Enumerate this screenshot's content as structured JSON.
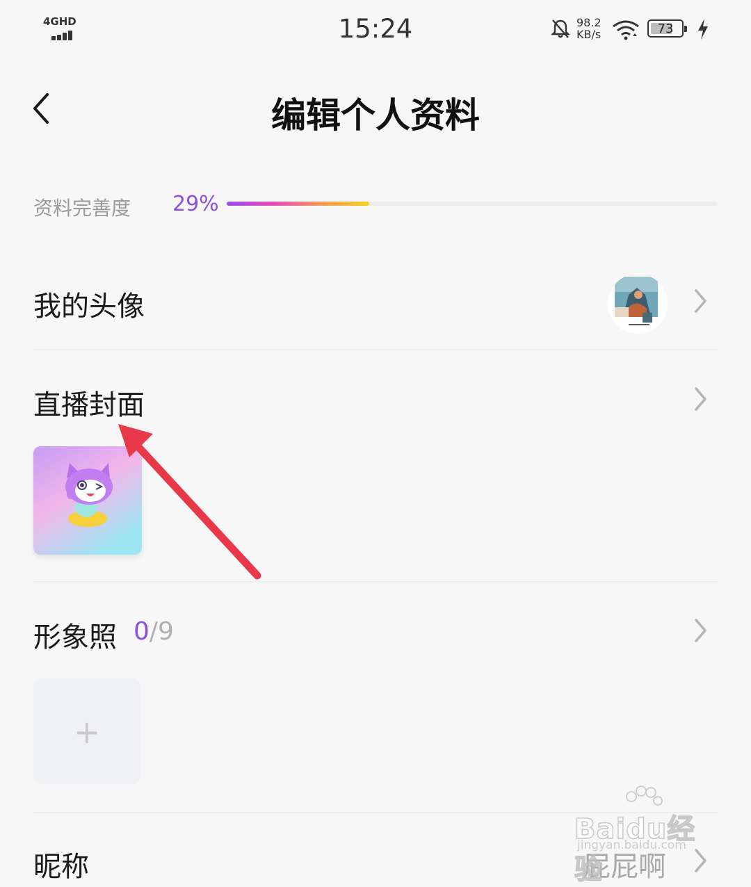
{
  "status_bar": {
    "network": "4GHD",
    "time": "15:24",
    "speed_value": "98.2",
    "speed_unit": "KB/s",
    "battery": "73",
    "icons": [
      "signal-icon",
      "bell-off-icon",
      "wifi-icon",
      "battery-icon",
      "charging-icon"
    ]
  },
  "header": {
    "title": "编辑个人资料",
    "back_icon": "back-arrow-icon"
  },
  "completeness": {
    "label": "资料完善度",
    "percent_text": "29%",
    "progress_fraction": 0.29,
    "gradient_colors": [
      "#9b4ff0",
      "#e64fb6",
      "#f59a5a",
      "#f5d020"
    ],
    "accent_color": "#8b4fe0"
  },
  "rows": {
    "avatar": {
      "label": "我的头像"
    },
    "cover": {
      "label": "直播封面"
    },
    "photos": {
      "label": "形象照",
      "count_current": "0",
      "count_rest": "/9",
      "add_symbol": "+"
    },
    "nickname": {
      "label": "昵称",
      "value": "屁屁啊"
    }
  },
  "watermark": {
    "brand": "Baidu经验",
    "domain": "jingyan.baidu.com"
  }
}
